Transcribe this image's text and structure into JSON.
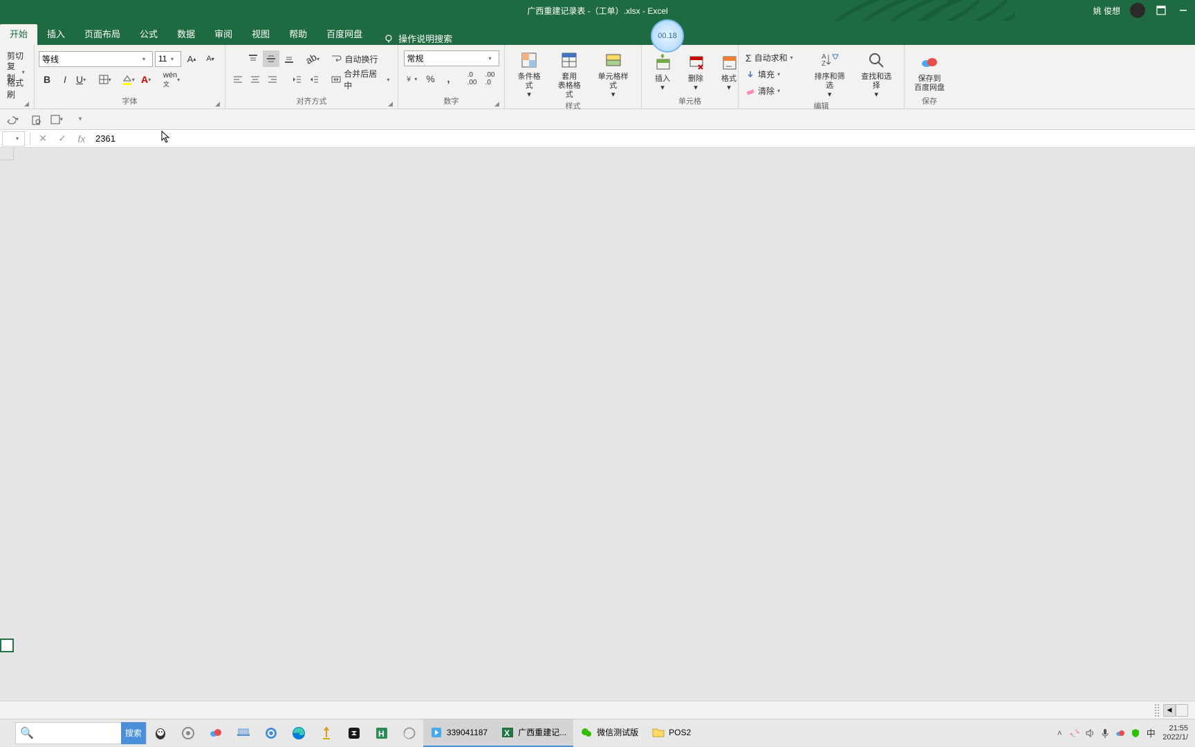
{
  "title": "广西重建记录表 -（工单）.xlsx - Excel",
  "user": "姚 俊想",
  "tabs": [
    "开始",
    "插入",
    "页面布局",
    "公式",
    "数据",
    "审阅",
    "视图",
    "帮助",
    "百度网盘"
  ],
  "tell_me": "操作说明搜索",
  "clipboard": {
    "cut": "剪切",
    "copy": "复制",
    "painter": "格式刷"
  },
  "font": {
    "name": "等线",
    "size": "11",
    "group": "字体"
  },
  "align": {
    "wrap": "自动换行",
    "merge": "合并后居中",
    "group": "对齐方式"
  },
  "number": {
    "format": "常规",
    "group": "数字"
  },
  "styles": {
    "cond": "条件格式",
    "table": "套用\n表格格式",
    "cell": "单元格样式",
    "group": "样式"
  },
  "cells": {
    "insert": "插入",
    "delete": "删除",
    "format": "格式",
    "group": "单元格"
  },
  "editing": {
    "sum": "自动求和",
    "fill": "填充",
    "clear": "清除",
    "sort": "排序和筛选",
    "find": "查找和选择",
    "group": "编辑"
  },
  "save": {
    "baidu": "保存到\n百度网盘",
    "group": "保存"
  },
  "formula_value": "2361",
  "fx": "fx",
  "timer": "00.18",
  "search_placeholder": "",
  "search_btn": "搜索",
  "taskbar_apps": [
    {
      "label": "339041187",
      "icon": "📋",
      "active": true
    },
    {
      "label": "广西重建记...",
      "icon": "x",
      "active": true,
      "excel": true
    },
    {
      "label": "微信测试版",
      "icon": "💬",
      "active": false
    },
    {
      "label": "POS2",
      "icon": "📁",
      "active": false
    }
  ],
  "ime": "中",
  "clock_time": "21:55",
  "clock_date": "2022/1/"
}
